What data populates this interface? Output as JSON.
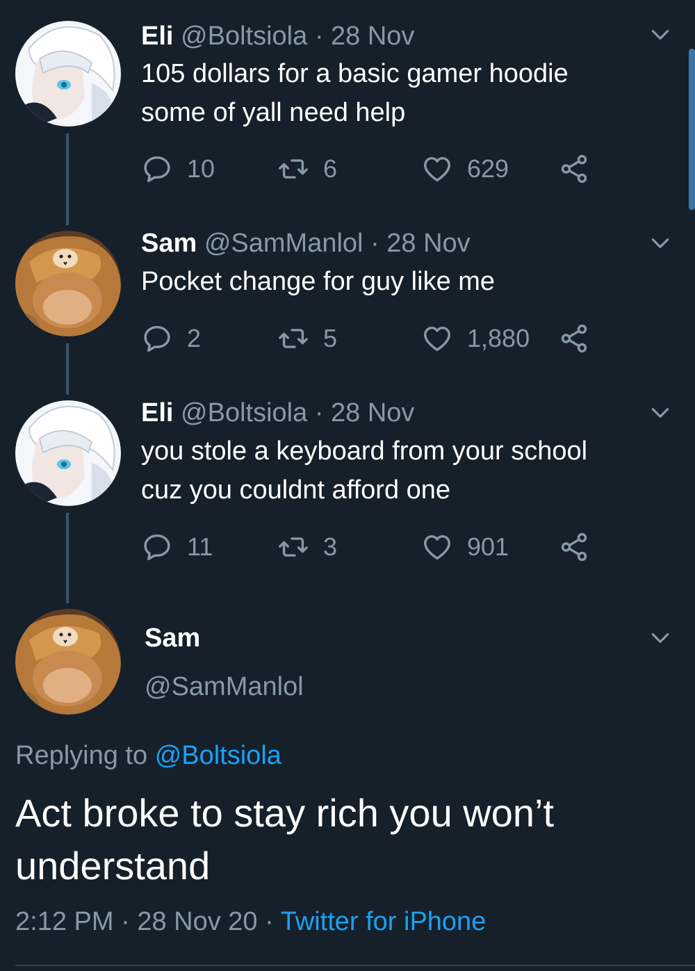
{
  "colors": {
    "background": "#15202b",
    "text": "#ffffff",
    "muted": "#8899a6",
    "link": "#1da1f2",
    "thread_line": "#3d5466"
  },
  "thread": [
    {
      "name": "Eli",
      "handle": "@Boltsiola",
      "sep": "·",
      "date": "28 Nov",
      "lines": [
        "105 dollars for a basic gamer hoodie",
        "some of yall need help"
      ],
      "replies": "10",
      "retweets": "6",
      "likes": "629",
      "avatar": "anime-avatar"
    },
    {
      "name": "Sam",
      "handle": "@SamManlol",
      "sep": "·",
      "date": "28 Nov",
      "lines": [
        "Pocket change for guy like me"
      ],
      "replies": "2",
      "retweets": "5",
      "likes": "1,880",
      "avatar": "cat-avatar"
    },
    {
      "name": "Eli",
      "handle": "@Boltsiola",
      "sep": "·",
      "date": "28 Nov",
      "lines": [
        "you stole a keyboard from your school",
        "cuz you couldnt afford one"
      ],
      "replies": "11",
      "retweets": "3",
      "likes": "901",
      "avatar": "anime-avatar"
    }
  ],
  "main": {
    "name": "Sam",
    "handle": "@SamManlol",
    "replying_label": "Replying to",
    "replying_handle": "@Boltsiola",
    "lines": [
      "Act broke to stay rich you won’t",
      "understand"
    ],
    "time": "2:12 PM",
    "date": "28 Nov 20",
    "source": "Twitter for iPhone",
    "sep": "·"
  },
  "icons": [
    "reply-icon",
    "retweet-icon",
    "like-icon",
    "share-icon",
    "chevron-down-icon"
  ]
}
